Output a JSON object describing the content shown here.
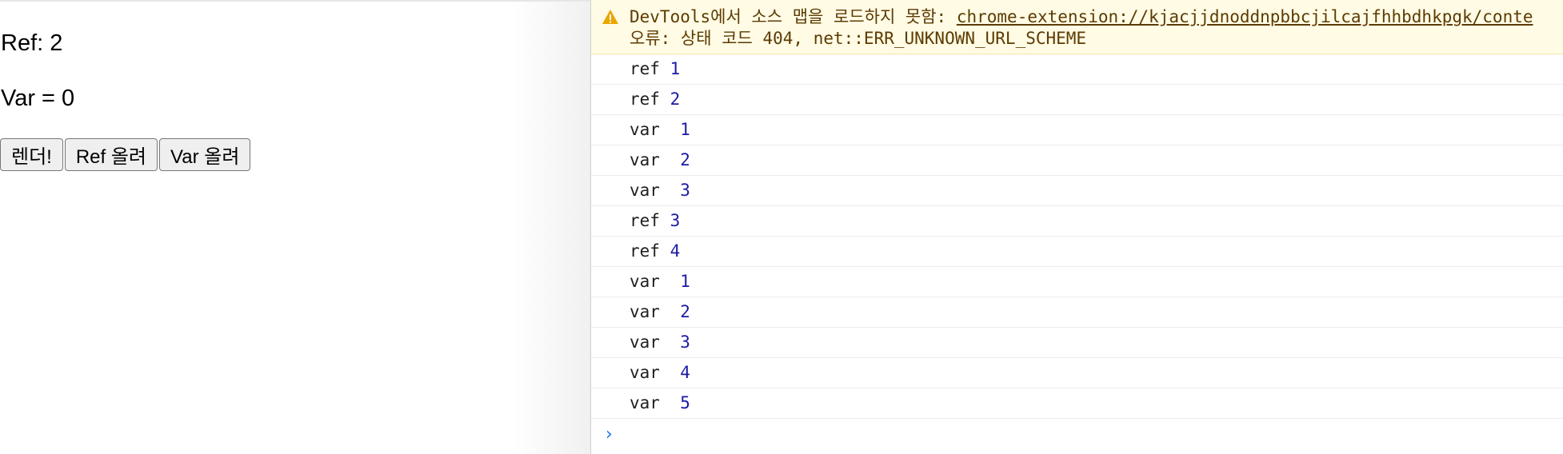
{
  "page": {
    "ref_text": "Ref: 2",
    "var_text": "Var = 0",
    "buttons": {
      "render": "렌더!",
      "ref_up": "Ref 올려",
      "var_up": "Var 올려"
    }
  },
  "console": {
    "warning": {
      "icon": "warning-icon",
      "line1_prefix": "DevTools에서 소스 맵을 로드하지 못함: ",
      "line1_link": "chrome-extension://kjacjjdnoddnpbbcjilcajfhhbdhkpgk/conte",
      "line2": "오류: 상태 코드 404, net::ERR_UNKNOWN_URL_SCHEME"
    },
    "logs": [
      {
        "label": "ref ",
        "value": "1"
      },
      {
        "label": "ref ",
        "value": "2"
      },
      {
        "label": "var  ",
        "value": "1"
      },
      {
        "label": "var  ",
        "value": "2"
      },
      {
        "label": "var  ",
        "value": "3"
      },
      {
        "label": "ref ",
        "value": "3"
      },
      {
        "label": "ref ",
        "value": "4"
      },
      {
        "label": "var  ",
        "value": "1"
      },
      {
        "label": "var  ",
        "value": "2"
      },
      {
        "label": "var  ",
        "value": "3"
      },
      {
        "label": "var  ",
        "value": "4"
      },
      {
        "label": "var  ",
        "value": "5"
      }
    ],
    "prompt_icon": "chevron-right-icon",
    "prompt_symbol": "›"
  },
  "colors": {
    "warning_bg": "#fffbe5",
    "warning_text": "#5c3b00",
    "warning_icon": "#e8a600",
    "number": "#1a1aa6",
    "prompt": "#1a73e8"
  }
}
